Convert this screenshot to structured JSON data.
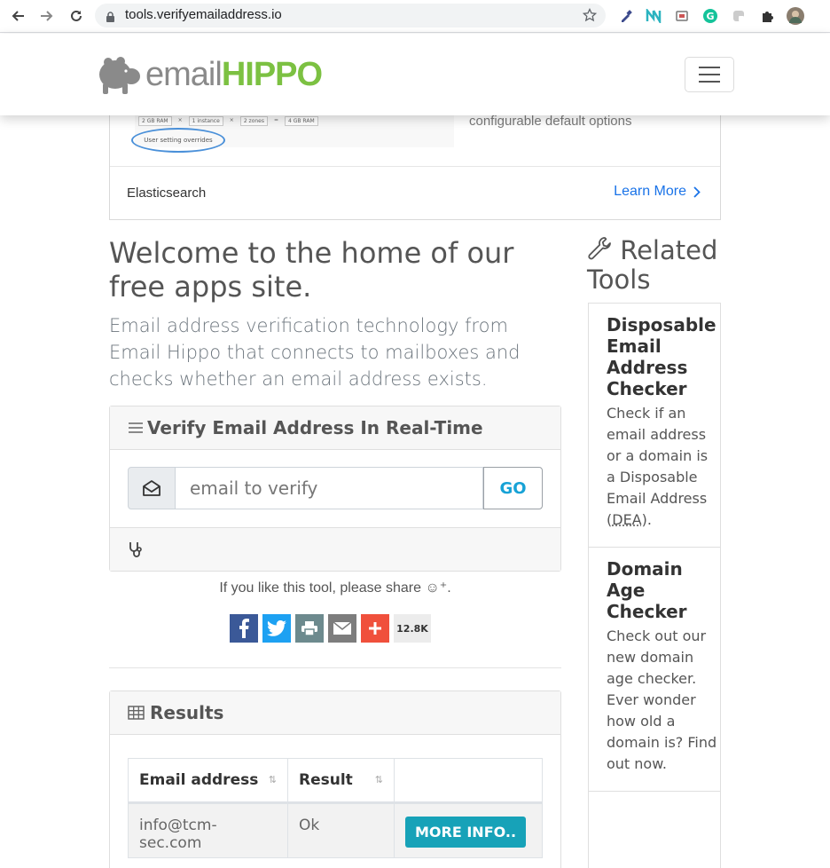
{
  "browser": {
    "url": "tools.verifyemailaddress.io"
  },
  "header": {
    "logo_email": "email",
    "logo_hippo": "HIPPO"
  },
  "ad": {
    "pills": [
      "2 GB RAM",
      "×",
      "1 instance",
      "×",
      "2 zones",
      "=",
      "4 GB RAM"
    ],
    "oval_text": "User setting overrides",
    "config_text": "configurable default options",
    "name": "Elasticsearch",
    "learn_more": "Learn More"
  },
  "main": {
    "title": "Welcome to the home of our free apps site.",
    "lead": "Email address verification technology from Email Hippo that connects to mailboxes and checks whether an email address exists.",
    "verify_card": {
      "title": "Verify Email Address In Real-Time",
      "placeholder": "email to verify",
      "go_label": "GO"
    },
    "share": {
      "text": "If you like this tool, please share ☺⁺.",
      "count": "12.8K"
    },
    "results": {
      "title": "Results",
      "columns": [
        "Email address",
        "Result",
        ""
      ],
      "rows": [
        {
          "email": "info@tcm-sec.com",
          "result": "Ok",
          "action": "MORE INFO.."
        }
      ]
    }
  },
  "sidebar": {
    "title": "Related Tools",
    "items": [
      {
        "title": "Disposable Email Address Checker",
        "desc_pre": "Check if an email address or a domain is a Disposable Email Address (",
        "abbr": "DEA",
        "desc_post": ")."
      },
      {
        "title": "Domain Age Checker",
        "desc": "Check out our new domain age checker. Ever wonder how old a domain is? Find out now."
      }
    ]
  },
  "colors": {
    "accent": "#17a2d6",
    "brand_green": "#7cc142",
    "more_info": "#17a2b8",
    "facebook": "#3b5998",
    "twitter": "#1da1f2",
    "print": "#6d8a8e",
    "email": "#7d7d7d",
    "more_share": "#f0503c"
  }
}
